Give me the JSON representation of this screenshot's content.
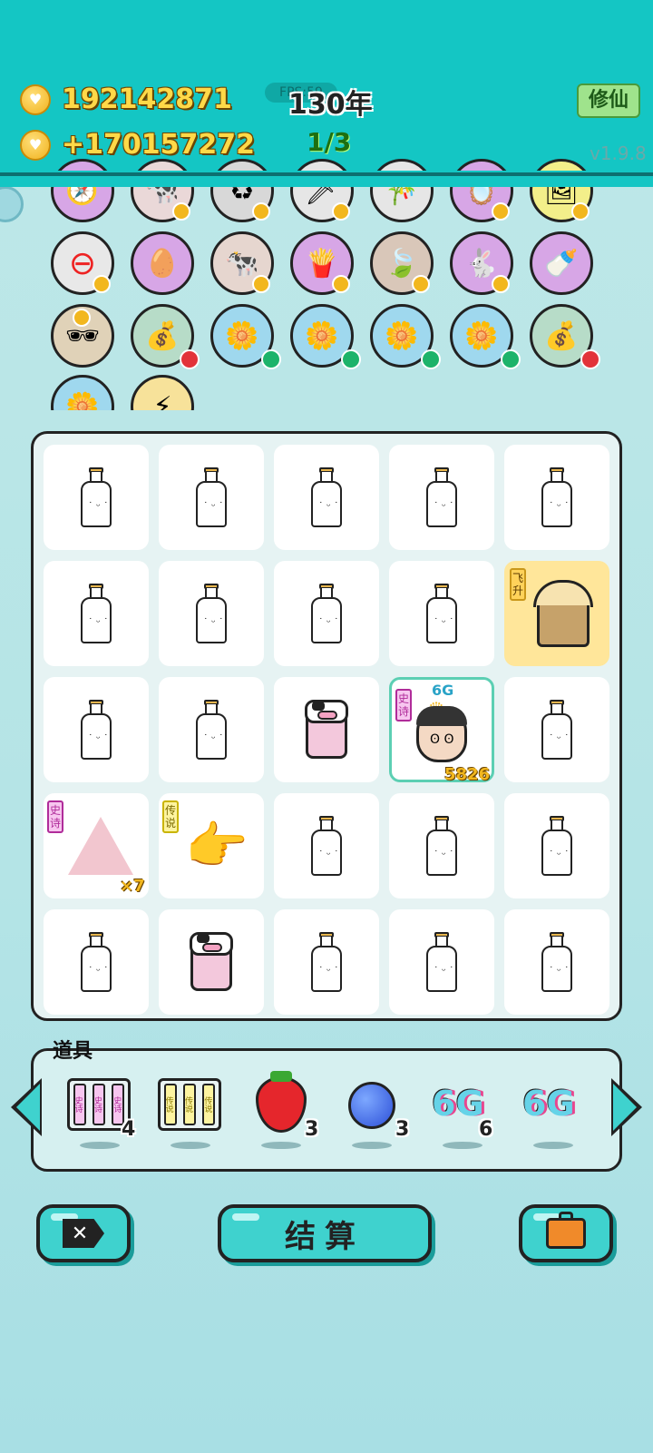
{
  "header": {
    "coins": "192142871",
    "income": "+170157272",
    "fps": "FPS:59",
    "years": "130年",
    "wave": "1/3",
    "cultivate_button": "修仙",
    "version": "v1.9.8"
  },
  "board": {
    "tags": {
      "ascend": "飞升",
      "epic": "史诗",
      "legend": "传说"
    },
    "character_level": "6G",
    "character_power": "5826",
    "house_multiplier": "×7"
  },
  "props": {
    "label": "道具",
    "items": [
      {
        "name": "epic-pack",
        "text": "史诗",
        "count": "4"
      },
      {
        "name": "legend-pack",
        "text": "传说",
        "count": ""
      },
      {
        "name": "strawberry",
        "text": "",
        "count": "3"
      },
      {
        "name": "blueberry",
        "text": "",
        "count": "3"
      },
      {
        "name": "6g-a",
        "text": "6G",
        "count": "6"
      },
      {
        "name": "6g-b",
        "text": "6G",
        "count": ""
      }
    ]
  },
  "buttons": {
    "settle": "结算"
  },
  "colors": {
    "top_bar": "#14c6c4",
    "gold": "#ffd948",
    "button": "#3fd2ce"
  }
}
